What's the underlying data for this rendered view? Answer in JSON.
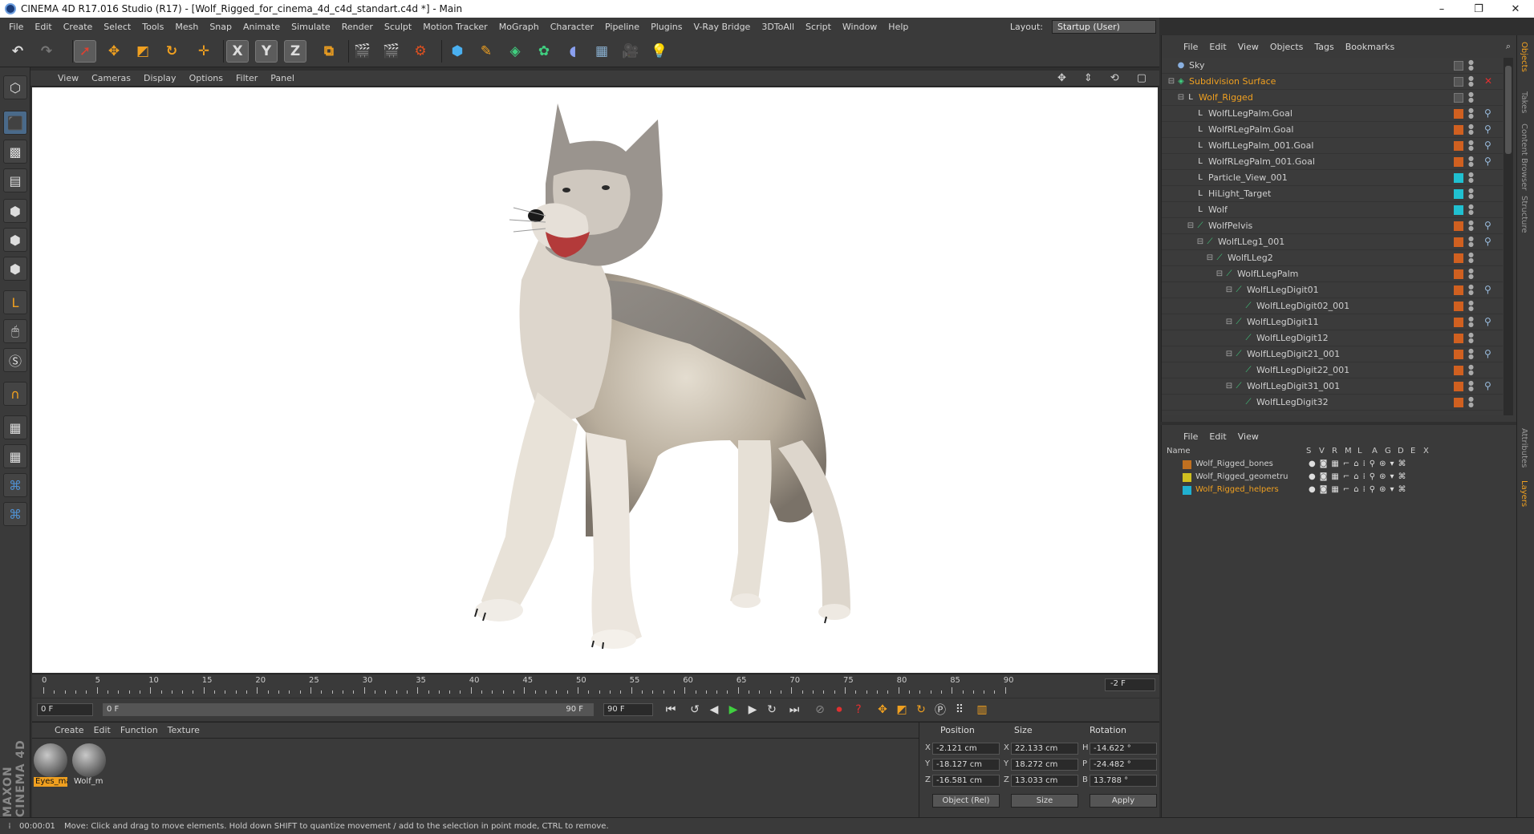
{
  "window": {
    "title": "CINEMA 4D R17.016 Studio (R17) - [Wolf_Rigged_for_cinema_4d_c4d_standart.c4d *] - Main",
    "controls": [
      "–",
      "❐",
      "✕"
    ]
  },
  "menu": {
    "items": [
      "File",
      "Edit",
      "Create",
      "Select",
      "Tools",
      "Mesh",
      "Snap",
      "Animate",
      "Simulate",
      "Render",
      "Sculpt",
      "Motion Tracker",
      "MoGraph",
      "Character",
      "Pipeline",
      "Plugins",
      "V-Ray Bridge",
      "3DToAll",
      "Script",
      "Window",
      "Help"
    ],
    "layout_label": "Layout:",
    "layout_value": "Startup (User)"
  },
  "toolbar": {
    "icons": [
      "undo-icon",
      "redo-icon",
      "select-arrow-icon",
      "move-icon",
      "scale-icon",
      "rotate-icon",
      "last-tool-icon",
      "x-axis-icon",
      "y-axis-icon",
      "z-axis-icon",
      "coordinate-system-icon",
      "render-view-icon",
      "render-picture-icon",
      "render-settings-icon",
      "cube-icon",
      "pen-icon",
      "subdivision-icon",
      "cloner-icon",
      "deformer-icon",
      "floor-icon",
      "camera-icon",
      "light-icon"
    ],
    "axis_labels": [
      "X",
      "Y",
      "Z"
    ]
  },
  "viewport": {
    "menu": [
      "View",
      "Cameras",
      "Display",
      "Options",
      "Filter",
      "Panel"
    ],
    "nav_icons": [
      "✥",
      "⇕",
      "⟲",
      "▢"
    ]
  },
  "timeline": {
    "ticks": [
      "0",
      "5",
      "10",
      "15",
      "20",
      "25",
      "30",
      "35",
      "40",
      "45",
      "50",
      "55",
      "60",
      "65",
      "70",
      "75",
      "80",
      "85",
      "90"
    ],
    "current_frame": "-2 F"
  },
  "transport": {
    "start": "0 F",
    "range_start": "0 F",
    "range_end": "90 F",
    "end": "90 F"
  },
  "material_manager": {
    "menu": [
      "Create",
      "Edit",
      "Function",
      "Texture"
    ],
    "materials": [
      {
        "name": "Eyes_ma",
        "selected": true
      },
      {
        "name": "Wolf_m",
        "selected": false
      }
    ]
  },
  "coordinates": {
    "headers": [
      "Position",
      "Size",
      "Rotation"
    ],
    "rows": [
      {
        "axis": "X",
        "pos": "-2.121 cm",
        "size_axis": "X",
        "size": "22.133 cm",
        "rot_axis": "H",
        "rot": "-14.622 °"
      },
      {
        "axis": "Y",
        "pos": "-18.127 cm",
        "size_axis": "Y",
        "size": "18.272 cm",
        "rot_axis": "P",
        "rot": "-24.482 °"
      },
      {
        "axis": "Z",
        "pos": "-16.581 cm",
        "size_axis": "Z",
        "size": "13.033 cm",
        "rot_axis": "B",
        "rot": "13.788 °"
      }
    ],
    "mode": "Object (Rel)",
    "size_mode": "Size",
    "apply": "Apply"
  },
  "status": {
    "time": "00:00:01",
    "message": "Move: Click and drag to move elements. Hold down SHIFT to quantize movement / add to the selection in point mode, CTRL to remove."
  },
  "object_manager": {
    "menu": [
      "File",
      "Edit",
      "View",
      "Objects",
      "Tags",
      "Bookmarks"
    ],
    "objects": [
      {
        "name": "Sky",
        "indent": 0,
        "color": "#cfcfcf",
        "tag": "",
        "type": "sky",
        "expander": ""
      },
      {
        "name": "Subdivision Surface",
        "indent": 0,
        "color": "#f0a020",
        "tag": "",
        "type": "subdiv",
        "expander": "⊟"
      },
      {
        "name": "Wolf_Rigged",
        "indent": 1,
        "color": "#f0a020",
        "tag": "",
        "type": "null",
        "expander": "⊟"
      },
      {
        "name": "WolfLLegPalm.Goal",
        "indent": 2,
        "color": "#cfcfcf",
        "tag": "#d06020",
        "type": "null",
        "expander": ""
      },
      {
        "name": "WolfRLegPalm.Goal",
        "indent": 2,
        "color": "#cfcfcf",
        "tag": "#d06020",
        "type": "null",
        "expander": ""
      },
      {
        "name": "WolfLLegPalm_001.Goal",
        "indent": 2,
        "color": "#cfcfcf",
        "tag": "#d06020",
        "type": "null",
        "expander": ""
      },
      {
        "name": "WolfRLegPalm_001.Goal",
        "indent": 2,
        "color": "#cfcfcf",
        "tag": "#d06020",
        "type": "null",
        "expander": ""
      },
      {
        "name": "Particle_View_001",
        "indent": 2,
        "color": "#cfcfcf",
        "tag": "#20c0d0",
        "type": "null",
        "expander": ""
      },
      {
        "name": "HiLight_Target",
        "indent": 2,
        "color": "#cfcfcf",
        "tag": "#20c0d0",
        "type": "null",
        "expander": ""
      },
      {
        "name": "Wolf",
        "indent": 2,
        "color": "#cfcfcf",
        "tag": "#20c0d0",
        "type": "null",
        "expander": ""
      },
      {
        "name": "WolfPelvis",
        "indent": 2,
        "color": "#cfcfcf",
        "tag": "#d06020",
        "type": "bone",
        "expander": "⊟"
      },
      {
        "name": "WolfLLeg1_001",
        "indent": 3,
        "color": "#cfcfcf",
        "tag": "#d06020",
        "type": "bone",
        "expander": "⊟"
      },
      {
        "name": "WolfLLeg2",
        "indent": 4,
        "color": "#cfcfcf",
        "tag": "#d06020",
        "type": "bone",
        "expander": "⊟"
      },
      {
        "name": "WolfLLegPalm",
        "indent": 5,
        "color": "#cfcfcf",
        "tag": "#d06020",
        "type": "bone",
        "expander": "⊟"
      },
      {
        "name": "WolfLLegDigit01",
        "indent": 6,
        "color": "#cfcfcf",
        "tag": "#d06020",
        "type": "bone",
        "expander": "⊟"
      },
      {
        "name": "WolfLLegDigit02_001",
        "indent": 7,
        "color": "#cfcfcf",
        "tag": "#d06020",
        "type": "bone",
        "expander": ""
      },
      {
        "name": "WolfLLegDigit11",
        "indent": 6,
        "color": "#cfcfcf",
        "tag": "#d06020",
        "type": "bone",
        "expander": "⊟"
      },
      {
        "name": "WolfLLegDigit12",
        "indent": 7,
        "color": "#cfcfcf",
        "tag": "#d06020",
        "type": "bone",
        "expander": ""
      },
      {
        "name": "WolfLLegDigit21_001",
        "indent": 6,
        "color": "#cfcfcf",
        "tag": "#d06020",
        "type": "bone",
        "expander": "⊟"
      },
      {
        "name": "WolfLLegDigit22_001",
        "indent": 7,
        "color": "#cfcfcf",
        "tag": "#d06020",
        "type": "bone",
        "expander": ""
      },
      {
        "name": "WolfLLegDigit31_001",
        "indent": 6,
        "color": "#cfcfcf",
        "tag": "#d06020",
        "type": "bone",
        "expander": "⊟"
      },
      {
        "name": "WolfLLegDigit32",
        "indent": 7,
        "color": "#cfcfcf",
        "tag": "#d06020",
        "type": "bone",
        "expander": ""
      }
    ]
  },
  "layer_manager": {
    "menu": [
      "File",
      "Edit",
      "View"
    ],
    "headers": [
      "Name",
      "S",
      "V",
      "R",
      "M",
      "L",
      "A",
      "G",
      "D",
      "E",
      "X"
    ],
    "layers": [
      {
        "name": "Wolf_Rigged_bones",
        "color": "#c07020",
        "text_color": "#cfcfcf"
      },
      {
        "name": "Wolf_Rigged_geometru",
        "color": "#d0c020",
        "text_color": "#cfcfcf"
      },
      {
        "name": "Wolf_Rigged_helpers",
        "color": "#20b0d0",
        "text_color": "#f0a020"
      }
    ]
  },
  "right_tabs": [
    "Objects",
    "Takes",
    "Content Browser",
    "Structure",
    "Attributes",
    "Layers"
  ],
  "brand": "MAXON CINEMA 4D",
  "colors": {
    "accent": "#f0a020",
    "panel": "#3a3a3a",
    "viewport_bg": "#ffffff"
  }
}
